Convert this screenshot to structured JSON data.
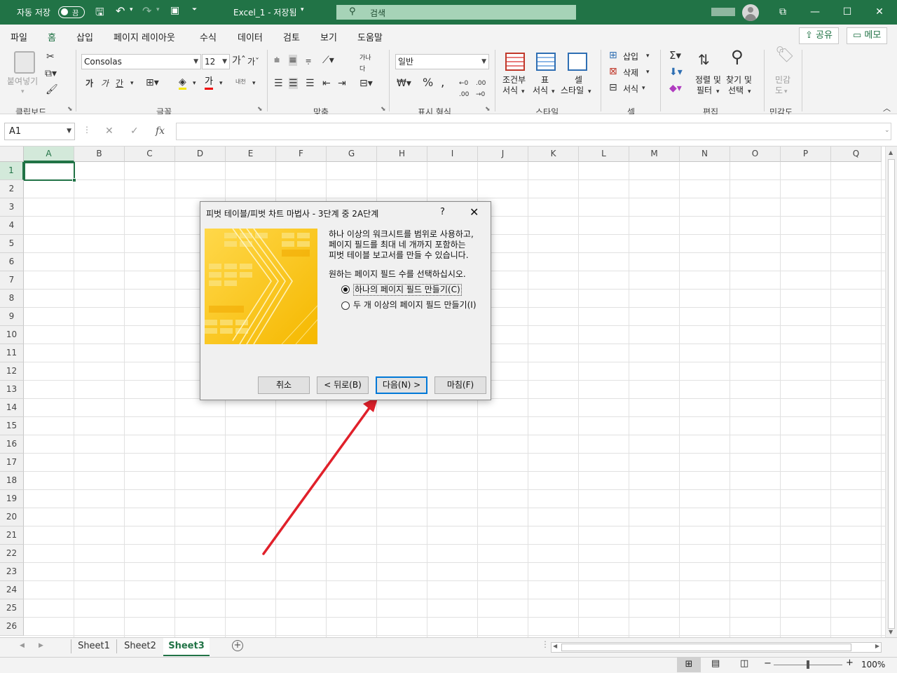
{
  "titlebar": {
    "autosave_label": "자동 저장",
    "autosave_state": "끔",
    "doc_title": "Excel_1 - 저장됨",
    "search_placeholder": "검색"
  },
  "ribbon_tabs": [
    "파일",
    "홈",
    "삽입",
    "페이지 레이아웃",
    "수식",
    "데이터",
    "검토",
    "보기",
    "도움말"
  ],
  "active_tab": "홈",
  "share_label": "공유",
  "memo_label": "메모",
  "ribbon": {
    "clipboard": {
      "paste": "붙여넣기",
      "group": "클립보드"
    },
    "font": {
      "name": "Consolas",
      "size": "12",
      "bold": "가",
      "italic": "가",
      "underline": "간",
      "fill": "가",
      "phonetic": "내천",
      "grow": "가",
      "shrink": "가",
      "group": "글꼴"
    },
    "alignment": {
      "group": "맞춤"
    },
    "number": {
      "format": "일반",
      "percent": "%",
      "group": "표시 형식"
    },
    "styles": {
      "conditional1": "조건부",
      "conditional2": "서식",
      "table1": "표",
      "table2": "서식",
      "cell1": "셀",
      "cell2": "스타일",
      "group": "스타일"
    },
    "cells": {
      "insert": "삽입",
      "delete": "삭제",
      "format": "서식",
      "group": "셀"
    },
    "editing": {
      "sort1": "정렬 및",
      "sort2": "필터",
      "find1": "찾기 및",
      "find2": "선택",
      "group": "편집"
    },
    "sensitivity": {
      "label1": "민감",
      "label2": "도",
      "group": "민감도"
    }
  },
  "formula_bar": {
    "namebox": "A1",
    "fx": "fx",
    "value": ""
  },
  "columns": [
    "A",
    "B",
    "C",
    "D",
    "E",
    "F",
    "G",
    "H",
    "I",
    "J",
    "K",
    "L",
    "M",
    "N",
    "O",
    "P",
    "Q"
  ],
  "rows": [
    "1",
    "2",
    "3",
    "4",
    "5",
    "6",
    "7",
    "8",
    "9",
    "10",
    "11",
    "12",
    "13",
    "14",
    "15",
    "16",
    "17",
    "18",
    "19",
    "20",
    "21",
    "22",
    "23",
    "24",
    "25",
    "26"
  ],
  "sheets": [
    "Sheet1",
    "Sheet2",
    "Sheet3"
  ],
  "active_sheet": "Sheet3",
  "zoom": "100%",
  "dialog": {
    "title": "피벗 테이블/피벗 차트 마법사 - 3단계 중 2A단계",
    "help": "?",
    "description": [
      "하나 이상의 워크시트를 범위로 사용하고,",
      "페이지 필드를 최대 네 개까지 포함하는",
      "피벗 테이블 보고서를 만들 수 있습니다."
    ],
    "question": "원하는 페이지 필드 수를 선택하십시오.",
    "options": [
      {
        "label": "하나의 페이지 필드 만들기(C)",
        "selected": true
      },
      {
        "label": "두 개 이상의 페이지 필드 만들기(I)",
        "selected": false
      }
    ],
    "buttons": {
      "cancel": "취소",
      "back": "< 뒤로(B)",
      "next": "다음(N) >",
      "finish": "마침(F)"
    }
  },
  "colors": {
    "accent": "#217346",
    "arrow": "#e0202a",
    "dialog_focus": "#0078d7"
  }
}
